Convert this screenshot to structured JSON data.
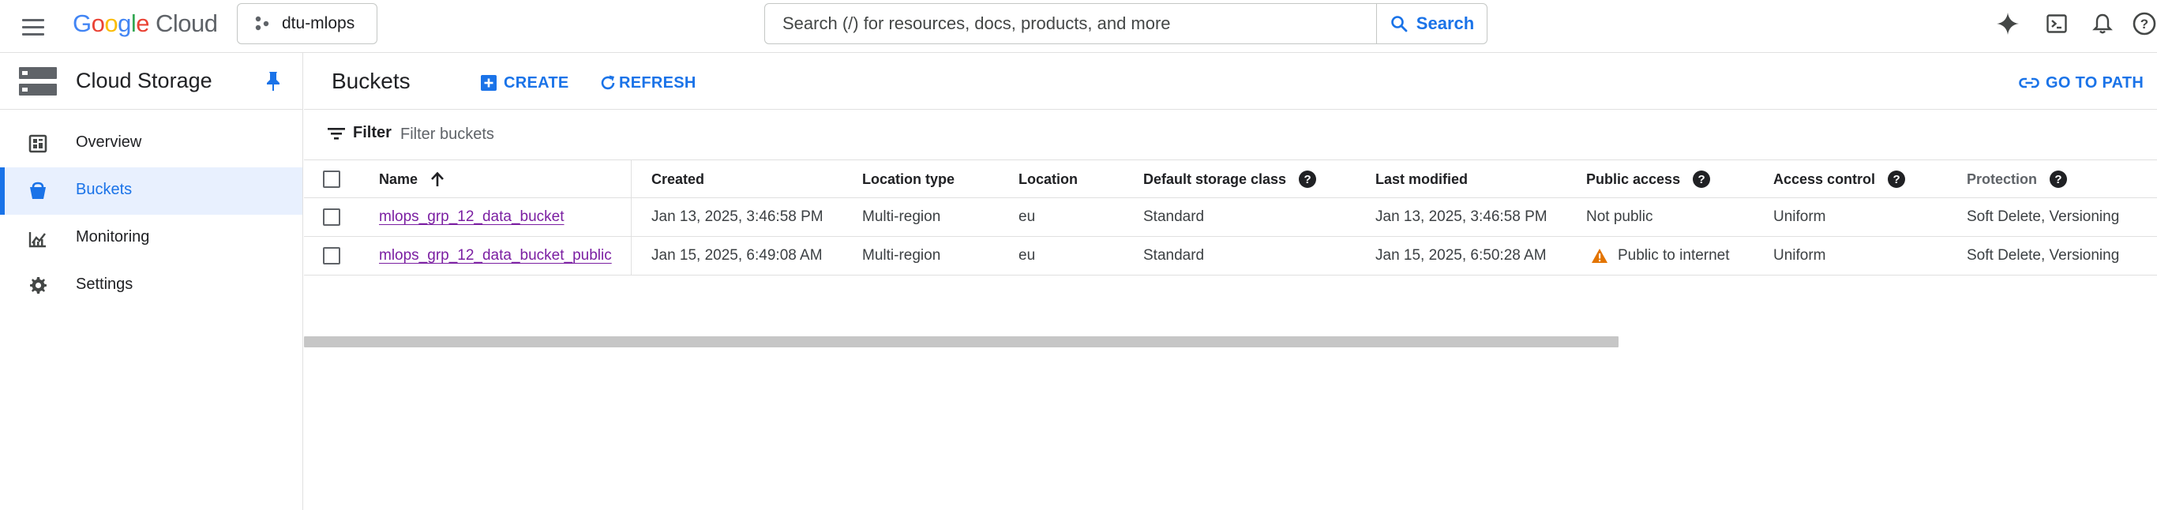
{
  "topbar": {
    "logo_google": "Google",
    "logo_cloud": "Cloud",
    "project": "dtu-mlops",
    "search_placeholder": "Search (/) for resources, docs, products, and more",
    "search_button": "Search"
  },
  "sidebar": {
    "title": "Cloud Storage",
    "items": [
      {
        "label": "Overview",
        "icon": "dashboard-icon"
      },
      {
        "label": "Buckets",
        "icon": "bucket-icon",
        "active": true
      },
      {
        "label": "Monitoring",
        "icon": "monitoring-icon"
      },
      {
        "label": "Settings",
        "icon": "gear-icon"
      }
    ]
  },
  "main": {
    "title": "Buckets",
    "create_label": "CREATE",
    "refresh_label": "REFRESH",
    "goto_path_label": "GO TO PATH",
    "filter_label": "Filter",
    "filter_placeholder": "Filter buckets",
    "columns": [
      "Name",
      "Created",
      "Location type",
      "Location",
      "Default storage class",
      "Last modified",
      "Public access",
      "Access control",
      "Protection"
    ],
    "rows": [
      {
        "name": "mlops_grp_12_data_bucket",
        "created": "Jan 13, 2025, 3:46:58 PM",
        "location_type": "Multi-region",
        "location": "eu",
        "storage_class": "Standard",
        "last_modified": "Jan 13, 2025, 3:46:58 PM",
        "public_access": "Not public",
        "access_control": "Uniform",
        "protection": "Soft Delete, Versioning"
      },
      {
        "name": "mlops_grp_12_data_bucket_public",
        "created": "Jan 15, 2025, 6:49:08 AM",
        "location_type": "Multi-region",
        "location": "eu",
        "storage_class": "Standard",
        "last_modified": "Jan 15, 2025, 6:50:28 AM",
        "public_access": "Public to internet",
        "access_control": "Uniform",
        "protection": "Soft Delete, Versioning"
      }
    ]
  },
  "colors": {
    "accent": "#1a73e8",
    "link_visited": "#7b1fa2",
    "warning": "#e37400"
  }
}
